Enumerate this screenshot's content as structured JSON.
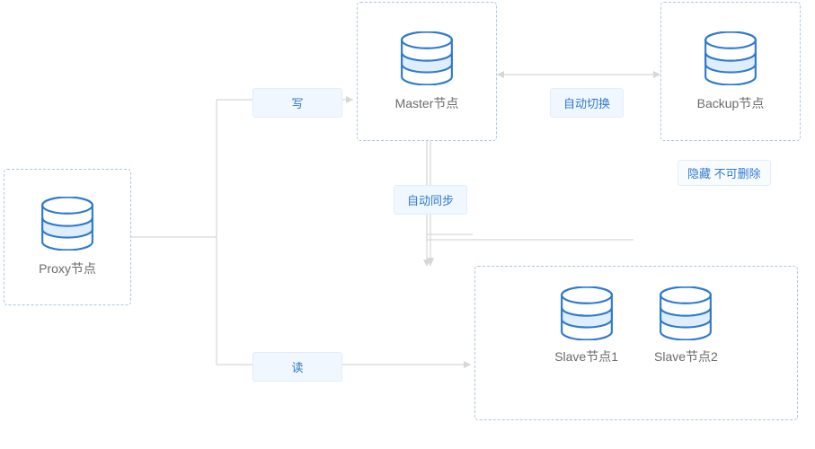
{
  "nodes": {
    "proxy": {
      "label": "Proxy节点"
    },
    "master": {
      "label": "Master节点"
    },
    "backup": {
      "label": "Backup节点"
    },
    "slave1": {
      "label": "Slave节点1"
    },
    "slave2": {
      "label": "Slave节点2"
    }
  },
  "edges": {
    "write": {
      "label": "写"
    },
    "read": {
      "label": "读"
    },
    "autosync": {
      "label": "自动同步"
    },
    "failover": {
      "label": "自动切换"
    }
  },
  "notes": {
    "hidden_no_delete": "隐藏 不可删除"
  },
  "colors": {
    "dash_border": "#a9c7e8",
    "icon_stroke": "#2f7ad1",
    "icon_fill": "#dfeefd",
    "badge_bg": "#f0f7ff",
    "connector": "#d7d7d7"
  }
}
